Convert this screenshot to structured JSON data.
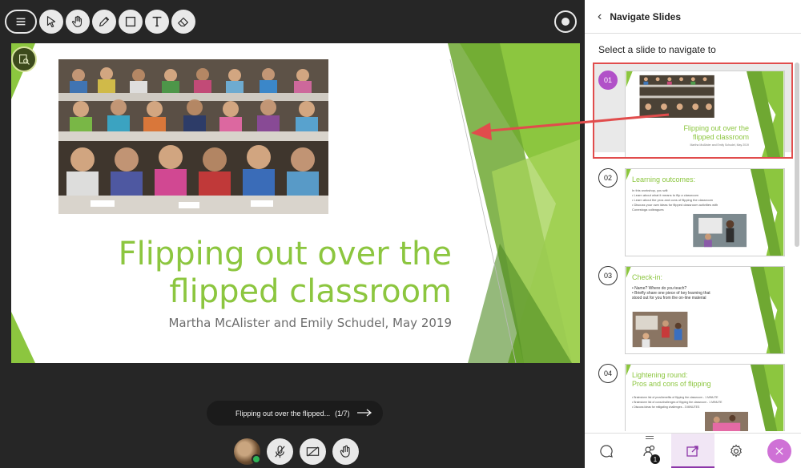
{
  "toolbar": {
    "items": [
      "menu-icon",
      "pointer-icon",
      "pan-hand-icon",
      "pencil-icon",
      "rectangle-icon",
      "text-icon",
      "eraser-icon"
    ]
  },
  "slide": {
    "title_line1": "Flipping out over the",
    "title_line2": "flipped classroom",
    "subtitle": "Martha McAlister and Emily Schudel, May 2019",
    "accent_color": "#8cc63f"
  },
  "slide_nav": {
    "title": "Flipping out over the flipped...",
    "counter": "(1/7)",
    "next_icon": "arrow-right-icon"
  },
  "panel": {
    "back_icon": "chevron-left-icon",
    "title": "Navigate Slides",
    "subtitle": "Select a slide to navigate to",
    "slides": [
      {
        "num": "01",
        "title_line1": "Flipping out over the",
        "title_line2": "flipped classroom",
        "caption": "Martha McAlister and Emily Schudel, May 2019",
        "selected": true
      },
      {
        "num": "02",
        "title": "Learning outcomes:",
        "lines": [
          "In this workshop, you will:",
          "• Learn about what it means to flip a classroom",
          "• Learn about the pros and cons of flipping the classroom",
          "• Discuss your own ideas for flipped classroom activities with",
          "  Conestoga colleagues"
        ],
        "selected": false
      },
      {
        "num": "03",
        "title": "Check-in:",
        "lines": [
          "• Name? Where do you teach?",
          "• Briefly share one piece of key learning that",
          "  stood out for you from the on-line material"
        ],
        "selected": false
      },
      {
        "num": "04",
        "title_line1": "Lightening round:",
        "title_line2": "Pros and cons of flipping",
        "lines": [
          "• Brainstorm list of pros/benefits of flipping the classroom - 1 MINUTE",
          "• Brainstorm list of cons/challenges of flipping the classroom - 1 MINUTE",
          "• Discuss ideas for mitigating challenges - 3 MINUTES"
        ],
        "selected": false
      }
    ]
  },
  "tabs": [
    {
      "name": "chat-icon",
      "active": false
    },
    {
      "name": "attendees-icon",
      "active": false,
      "badge": "1"
    },
    {
      "name": "share-content-icon",
      "active": true
    },
    {
      "name": "settings-gear-icon",
      "active": false
    },
    {
      "name": "close-panel-icon",
      "active": false
    }
  ],
  "colors": {
    "stage_bg": "#262626",
    "selected_badge": "#b151c8",
    "annotation_red": "#e14c4c",
    "active_tab": "#8c36a8"
  }
}
